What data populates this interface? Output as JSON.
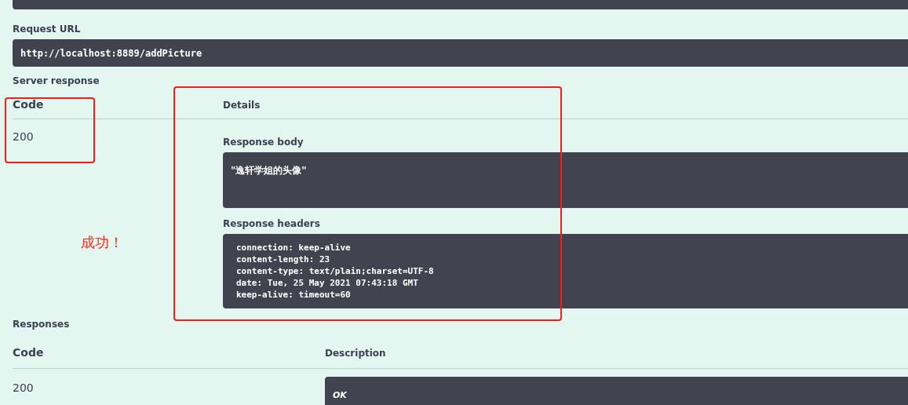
{
  "request_url": {
    "label": "Request URL",
    "value": "http://localhost:8889/addPicture"
  },
  "server_response": {
    "label": "Server response",
    "columns": [
      "Code",
      "Details"
    ],
    "code": "200",
    "body_label": "Response body",
    "body": "\"逸轩学姐的头像\"",
    "headers_label": "Response headers",
    "headers": [
      "connection: keep-alive",
      "content-length: 23",
      "content-type: text/plain;charset=UTF-8",
      "date: Tue, 25 May 2021 07:43:18 GMT",
      "keep-alive: timeout=60"
    ]
  },
  "annotation": {
    "text": "成功！"
  },
  "responses": {
    "label": "Responses",
    "columns": [
      "Code",
      "Description"
    ],
    "rows": [
      {
        "code": "200",
        "description": "OK"
      }
    ]
  }
}
